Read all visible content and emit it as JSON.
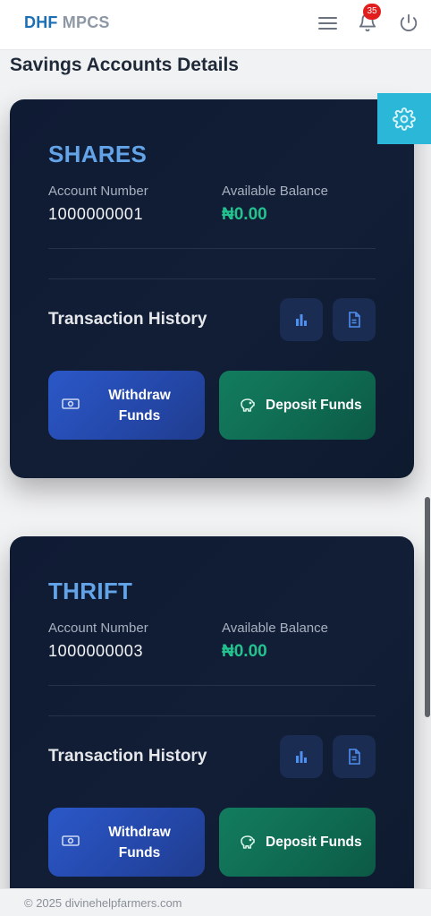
{
  "header": {
    "brand_primary": "DHF",
    "brand_secondary": "MPCS",
    "notification_count": "35"
  },
  "page_title": "Savings Accounts Details",
  "accounts": [
    {
      "name": "SHARES",
      "account_number_label": "Account Number",
      "account_number": "1000000001",
      "balance_label": "Available Balance",
      "balance": "₦0.00",
      "transaction_history_label": "Transaction History",
      "withdraw_label": "Withdraw Funds",
      "deposit_label": "Deposit Funds"
    },
    {
      "name": "THRIFT",
      "account_number_label": "Account Number",
      "account_number": "1000000003",
      "balance_label": "Available Balance",
      "balance": "₦0.00",
      "transaction_history_label": "Transaction History",
      "withdraw_label": "Withdraw Funds",
      "deposit_label": "Deposit Funds"
    }
  ],
  "footer": {
    "copyright": "© 2025 divinehelpfarmers.com"
  },
  "colors": {
    "brand_blue": "#1d6fb5",
    "card_bg": "#0f1a33",
    "account_title": "#63a4e8",
    "balance_green": "#22c38e",
    "withdraw_blue": "#2b58c8",
    "deposit_green": "#137c5e",
    "settings_tab": "#2bb8d8",
    "badge_red": "#e11d1d"
  },
  "icons": {
    "menu": "hamburger-icon",
    "notifications": "bell-icon",
    "logout": "power-icon",
    "settings": "gear-icon",
    "stats": "bar-chart-icon",
    "statement": "document-icon",
    "withdraw": "cash-icon",
    "deposit": "piggy-bank-icon"
  }
}
